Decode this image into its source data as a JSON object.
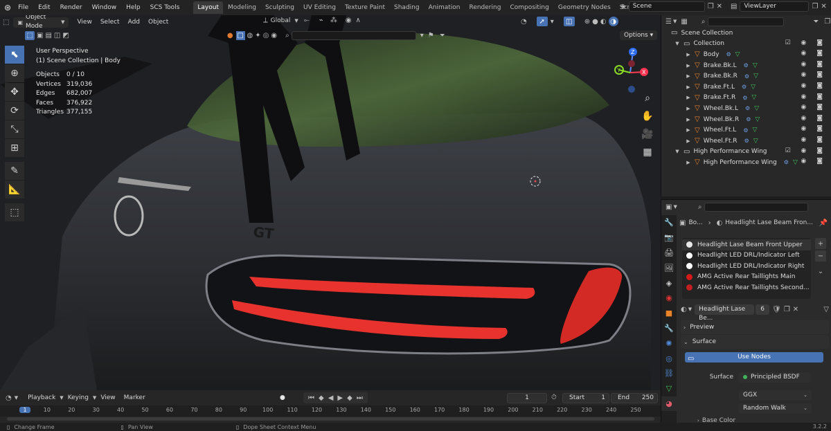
{
  "topbar": {
    "menus": [
      "File",
      "Edit",
      "Render",
      "Window",
      "Help",
      "SCS Tools"
    ],
    "workspaces": [
      "Layout",
      "Modeling",
      "Sculpting",
      "UV Editing",
      "Texture Paint",
      "Shading",
      "Animation",
      "Rendering",
      "Compositing",
      "Geometry Nodes",
      "Scripting"
    ],
    "active_workspace": "Layout",
    "scene": "Scene",
    "view_layer": "ViewLayer"
  },
  "viewport": {
    "mode": "Object Mode",
    "menus": [
      "View",
      "Select",
      "Add",
      "Object"
    ],
    "orientation": "Global",
    "options": "Options",
    "perspective": "User Perspective",
    "collection_info": "(1) Scene Collection | Body",
    "stats": [
      {
        "k": "Objects",
        "v": "0 / 10"
      },
      {
        "k": "Vertices",
        "v": "319,036"
      },
      {
        "k": "Edges",
        "v": "682,007"
      },
      {
        "k": "Faces",
        "v": "376,922"
      },
      {
        "k": "Triangles",
        "v": "377,155"
      }
    ],
    "gizmo": {
      "z": "Z",
      "x": "X",
      "y": "Y"
    }
  },
  "timeline": {
    "menus": [
      "Playback",
      "Keying",
      "View",
      "Marker"
    ],
    "current_frame": "1",
    "start_label": "Start",
    "start": "1",
    "end_label": "End",
    "end": "250",
    "ruler": [
      "1",
      "10",
      "20",
      "30",
      "40",
      "50",
      "60",
      "70",
      "80",
      "90",
      "100",
      "110",
      "120",
      "130",
      "140",
      "150",
      "160",
      "170",
      "180",
      "190",
      "200",
      "210",
      "220",
      "230",
      "240",
      "250"
    ]
  },
  "statusbar": {
    "items": [
      "Change Frame",
      "Pan View",
      "Dope Sheet Context Menu"
    ],
    "version": "3.2.2"
  },
  "outliner": {
    "root": "Scene Collection",
    "rows": [
      {
        "label": "Collection",
        "indent": 1,
        "type": "collection"
      },
      {
        "label": "Body",
        "indent": 2,
        "type": "object"
      },
      {
        "label": "Brake.Bk.L",
        "indent": 2,
        "type": "object"
      },
      {
        "label": "Brake.Bk.R",
        "indent": 2,
        "type": "object"
      },
      {
        "label": "Brake.Ft.L",
        "indent": 2,
        "type": "object"
      },
      {
        "label": "Brake.Ft.R",
        "indent": 2,
        "type": "object"
      },
      {
        "label": "Wheel.Bk.L",
        "indent": 2,
        "type": "object"
      },
      {
        "label": "Wheel.Bk.R",
        "indent": 2,
        "type": "object"
      },
      {
        "label": "Wheel.Ft.L",
        "indent": 2,
        "type": "object"
      },
      {
        "label": "Wheel.Ft.R",
        "indent": 2,
        "type": "object"
      },
      {
        "label": "High Performance Wing",
        "indent": 1,
        "type": "collection"
      },
      {
        "label": "High Performance Wing",
        "indent": 2,
        "type": "object"
      }
    ]
  },
  "properties": {
    "breadcrumb_object": "Bo...",
    "breadcrumb_material": "Headlight Lase Beam Fron...",
    "materials": [
      {
        "name": "Headlight Lase Beam Front Upper",
        "color": "#e8e8e8"
      },
      {
        "name": "Headlight LED DRL/Indicator Left",
        "color": "#ffffff"
      },
      {
        "name": "Headlight LED DRL/Indicator Right",
        "color": "#ffffff"
      },
      {
        "name": "AMG Active Rear Taillights Main",
        "color": "#d11a1a"
      },
      {
        "name": "AMG Active Rear Taillights Second...",
        "color": "#c0201f"
      }
    ],
    "active_material": "Headlight Lase Be...",
    "user_count": "6",
    "preview": "Preview",
    "surface": "Surface",
    "use_nodes": "Use Nodes",
    "surface_label": "Surface",
    "surface_value": "Principled BSDF",
    "distribution": "GGX",
    "subsurface": "Random Walk",
    "base_color_partial": "Base Color"
  },
  "colors": {
    "accent": "#4772b3",
    "taillight": "#e8322d"
  }
}
